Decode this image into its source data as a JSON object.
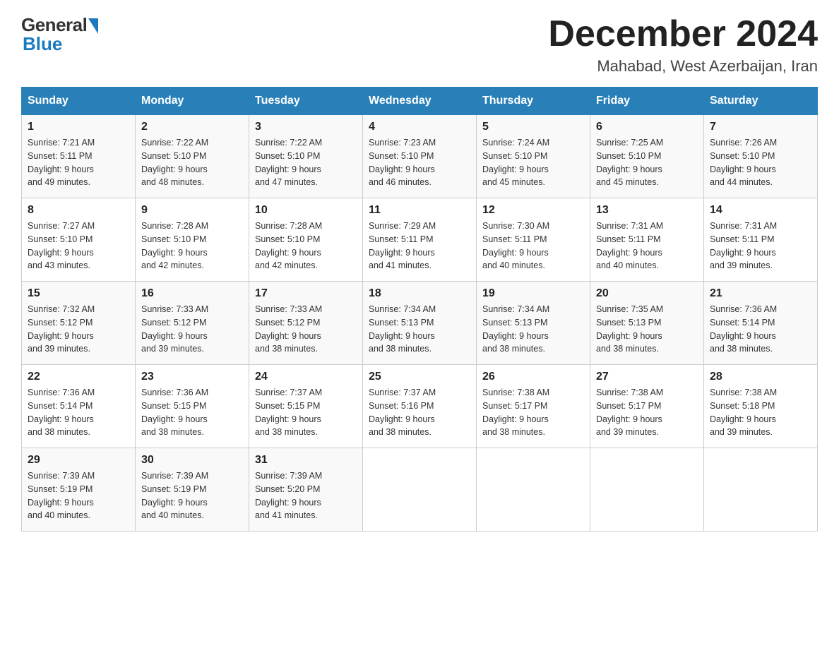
{
  "logo": {
    "general": "General",
    "blue": "Blue"
  },
  "title": "December 2024",
  "location": "Mahabad, West Azerbaijan, Iran",
  "days_of_week": [
    "Sunday",
    "Monday",
    "Tuesday",
    "Wednesday",
    "Thursday",
    "Friday",
    "Saturday"
  ],
  "weeks": [
    [
      {
        "day": "1",
        "sunrise": "7:21 AM",
        "sunset": "5:11 PM",
        "daylight": "9 hours and 49 minutes."
      },
      {
        "day": "2",
        "sunrise": "7:22 AM",
        "sunset": "5:10 PM",
        "daylight": "9 hours and 48 minutes."
      },
      {
        "day": "3",
        "sunrise": "7:22 AM",
        "sunset": "5:10 PM",
        "daylight": "9 hours and 47 minutes."
      },
      {
        "day": "4",
        "sunrise": "7:23 AM",
        "sunset": "5:10 PM",
        "daylight": "9 hours and 46 minutes."
      },
      {
        "day": "5",
        "sunrise": "7:24 AM",
        "sunset": "5:10 PM",
        "daylight": "9 hours and 45 minutes."
      },
      {
        "day": "6",
        "sunrise": "7:25 AM",
        "sunset": "5:10 PM",
        "daylight": "9 hours and 45 minutes."
      },
      {
        "day": "7",
        "sunrise": "7:26 AM",
        "sunset": "5:10 PM",
        "daylight": "9 hours and 44 minutes."
      }
    ],
    [
      {
        "day": "8",
        "sunrise": "7:27 AM",
        "sunset": "5:10 PM",
        "daylight": "9 hours and 43 minutes."
      },
      {
        "day": "9",
        "sunrise": "7:28 AM",
        "sunset": "5:10 PM",
        "daylight": "9 hours and 42 minutes."
      },
      {
        "day": "10",
        "sunrise": "7:28 AM",
        "sunset": "5:10 PM",
        "daylight": "9 hours and 42 minutes."
      },
      {
        "day": "11",
        "sunrise": "7:29 AM",
        "sunset": "5:11 PM",
        "daylight": "9 hours and 41 minutes."
      },
      {
        "day": "12",
        "sunrise": "7:30 AM",
        "sunset": "5:11 PM",
        "daylight": "9 hours and 40 minutes."
      },
      {
        "day": "13",
        "sunrise": "7:31 AM",
        "sunset": "5:11 PM",
        "daylight": "9 hours and 40 minutes."
      },
      {
        "day": "14",
        "sunrise": "7:31 AM",
        "sunset": "5:11 PM",
        "daylight": "9 hours and 39 minutes."
      }
    ],
    [
      {
        "day": "15",
        "sunrise": "7:32 AM",
        "sunset": "5:12 PM",
        "daylight": "9 hours and 39 minutes."
      },
      {
        "day": "16",
        "sunrise": "7:33 AM",
        "sunset": "5:12 PM",
        "daylight": "9 hours and 39 minutes."
      },
      {
        "day": "17",
        "sunrise": "7:33 AM",
        "sunset": "5:12 PM",
        "daylight": "9 hours and 38 minutes."
      },
      {
        "day": "18",
        "sunrise": "7:34 AM",
        "sunset": "5:13 PM",
        "daylight": "9 hours and 38 minutes."
      },
      {
        "day": "19",
        "sunrise": "7:34 AM",
        "sunset": "5:13 PM",
        "daylight": "9 hours and 38 minutes."
      },
      {
        "day": "20",
        "sunrise": "7:35 AM",
        "sunset": "5:13 PM",
        "daylight": "9 hours and 38 minutes."
      },
      {
        "day": "21",
        "sunrise": "7:36 AM",
        "sunset": "5:14 PM",
        "daylight": "9 hours and 38 minutes."
      }
    ],
    [
      {
        "day": "22",
        "sunrise": "7:36 AM",
        "sunset": "5:14 PM",
        "daylight": "9 hours and 38 minutes."
      },
      {
        "day": "23",
        "sunrise": "7:36 AM",
        "sunset": "5:15 PM",
        "daylight": "9 hours and 38 minutes."
      },
      {
        "day": "24",
        "sunrise": "7:37 AM",
        "sunset": "5:15 PM",
        "daylight": "9 hours and 38 minutes."
      },
      {
        "day": "25",
        "sunrise": "7:37 AM",
        "sunset": "5:16 PM",
        "daylight": "9 hours and 38 minutes."
      },
      {
        "day": "26",
        "sunrise": "7:38 AM",
        "sunset": "5:17 PM",
        "daylight": "9 hours and 38 minutes."
      },
      {
        "day": "27",
        "sunrise": "7:38 AM",
        "sunset": "5:17 PM",
        "daylight": "9 hours and 39 minutes."
      },
      {
        "day": "28",
        "sunrise": "7:38 AM",
        "sunset": "5:18 PM",
        "daylight": "9 hours and 39 minutes."
      }
    ],
    [
      {
        "day": "29",
        "sunrise": "7:39 AM",
        "sunset": "5:19 PM",
        "daylight": "9 hours and 40 minutes."
      },
      {
        "day": "30",
        "sunrise": "7:39 AM",
        "sunset": "5:19 PM",
        "daylight": "9 hours and 40 minutes."
      },
      {
        "day": "31",
        "sunrise": "7:39 AM",
        "sunset": "5:20 PM",
        "daylight": "9 hours and 41 minutes."
      },
      null,
      null,
      null,
      null
    ]
  ],
  "labels": {
    "sunrise": "Sunrise:",
    "sunset": "Sunset:",
    "daylight": "Daylight:"
  }
}
